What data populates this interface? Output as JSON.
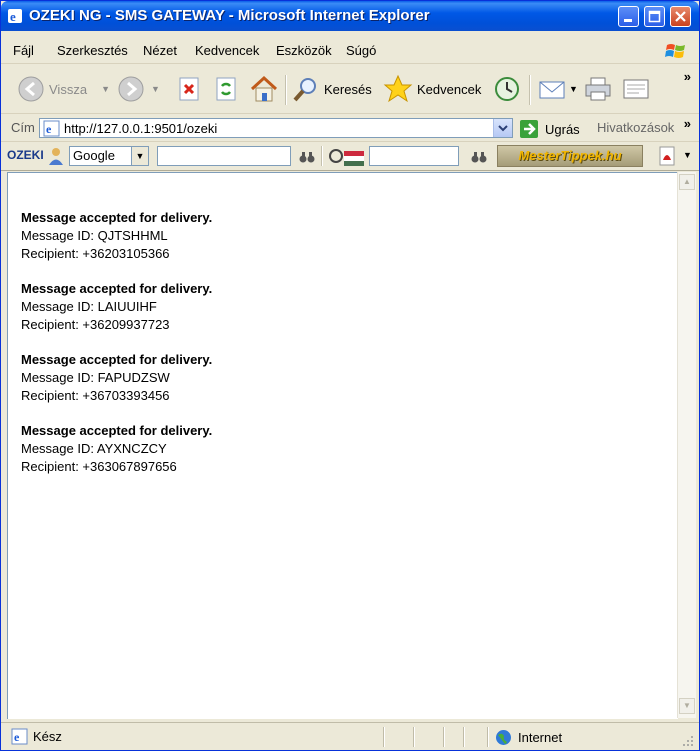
{
  "window": {
    "title": "OZEKI NG - SMS GATEWAY - Microsoft Internet Explorer"
  },
  "menu": {
    "items": [
      "Fájl",
      "Szerkesztés",
      "Nézet",
      "Kedvencek",
      "Eszközök",
      "Súgó"
    ]
  },
  "toolbar": {
    "back_label": "Vissza",
    "search_label": "Keresés",
    "favorites_label": "Kedvencek",
    "more": "»"
  },
  "address": {
    "label": "Cím",
    "url": "http://127.0.0.1:9501/ozeki",
    "go_label": "Ugrás",
    "links_label": "Hivatkozások",
    "more": "»"
  },
  "googlebar": {
    "brand": "OZEKI",
    "engine": "Google",
    "partner": "MesterTippek.hu"
  },
  "messages": [
    {
      "heading": "Message accepted for delivery.",
      "id_line": "Message ID: QJTSHHML",
      "recipient_line": "Recipient: +36203105366"
    },
    {
      "heading": "Message accepted for delivery.",
      "id_line": "Message ID: LAIUUIHF",
      "recipient_line": "Recipient: +36209937723"
    },
    {
      "heading": "Message accepted for delivery.",
      "id_line": "Message ID: FAPUDZSW",
      "recipient_line": "Recipient: +36703393456"
    },
    {
      "heading": "Message accepted for delivery.",
      "id_line": "Message ID: AYXNCZCY",
      "recipient_line": "Recipient: +363067897656"
    }
  ],
  "status": {
    "text": "Kész",
    "zone": "Internet"
  },
  "colors": {
    "titlebar": "#0054e3",
    "chrome": "#ece9d8"
  }
}
